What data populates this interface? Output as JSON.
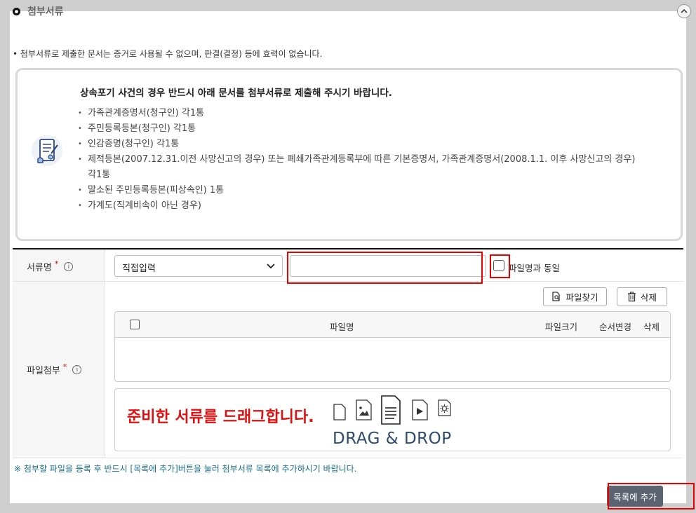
{
  "section": {
    "title": "첨부서류",
    "collapse_icon": "chevron-up-icon"
  },
  "notice": "첨부서류로 제출한 문서는 증거로 사용될 수 없으며, 판결(결정) 등에 효력이 없습니다.",
  "info_box": {
    "icon": "document-certificate-icon",
    "title": "상속포기 사건의 경우 반드시 아래 문서를 첨부서류로 제출해 주시기 바랍니다.",
    "items": [
      "가족관계증명서(청구인) 각1통",
      "주민등록등본(청구인) 각1통",
      "인감증명(청구인) 각1통",
      "제적등본(2007.12.31.이전 사망신고의 경우) 또는 폐쇄가족관계등록부에 따른 기본증명서, 가족관계증명서(2008.1.1. 이후 사망신고의 경우) 각1통",
      "말소된 주민등록등본(피상속인) 1통",
      "가계도(직계비속이 아닌 경우)"
    ]
  },
  "form": {
    "doc_name_label": "서류명",
    "required_mark": "*",
    "info_mark": "i",
    "doc_type_selected": "직접입력",
    "doc_name_value": "",
    "same_as_filename_label": "파일명과 동일",
    "attach_label": "파일첨부",
    "find_file_btn": "파일찾기",
    "delete_btn": "삭제",
    "table_headers": {
      "filename": "파일명",
      "size": "파일크기",
      "order": "순서변경",
      "delete": "삭제"
    },
    "drop_message": "준비한 서류를 드래그합니다.",
    "drop_caption": "DRAG & DROP"
  },
  "bottom_note": "※ 첨부할 파일을 등록 후 반드시 [목록에 추가]버튼을 눌러 첨부서류 목록에 추가하시기 바랍니다.",
  "add_to_list_btn": "목록에 추가",
  "colors": {
    "highlight": "#e00000",
    "drop_text": "#e01010",
    "note_text": "#1a6e86",
    "add_button": "#5c6370"
  }
}
